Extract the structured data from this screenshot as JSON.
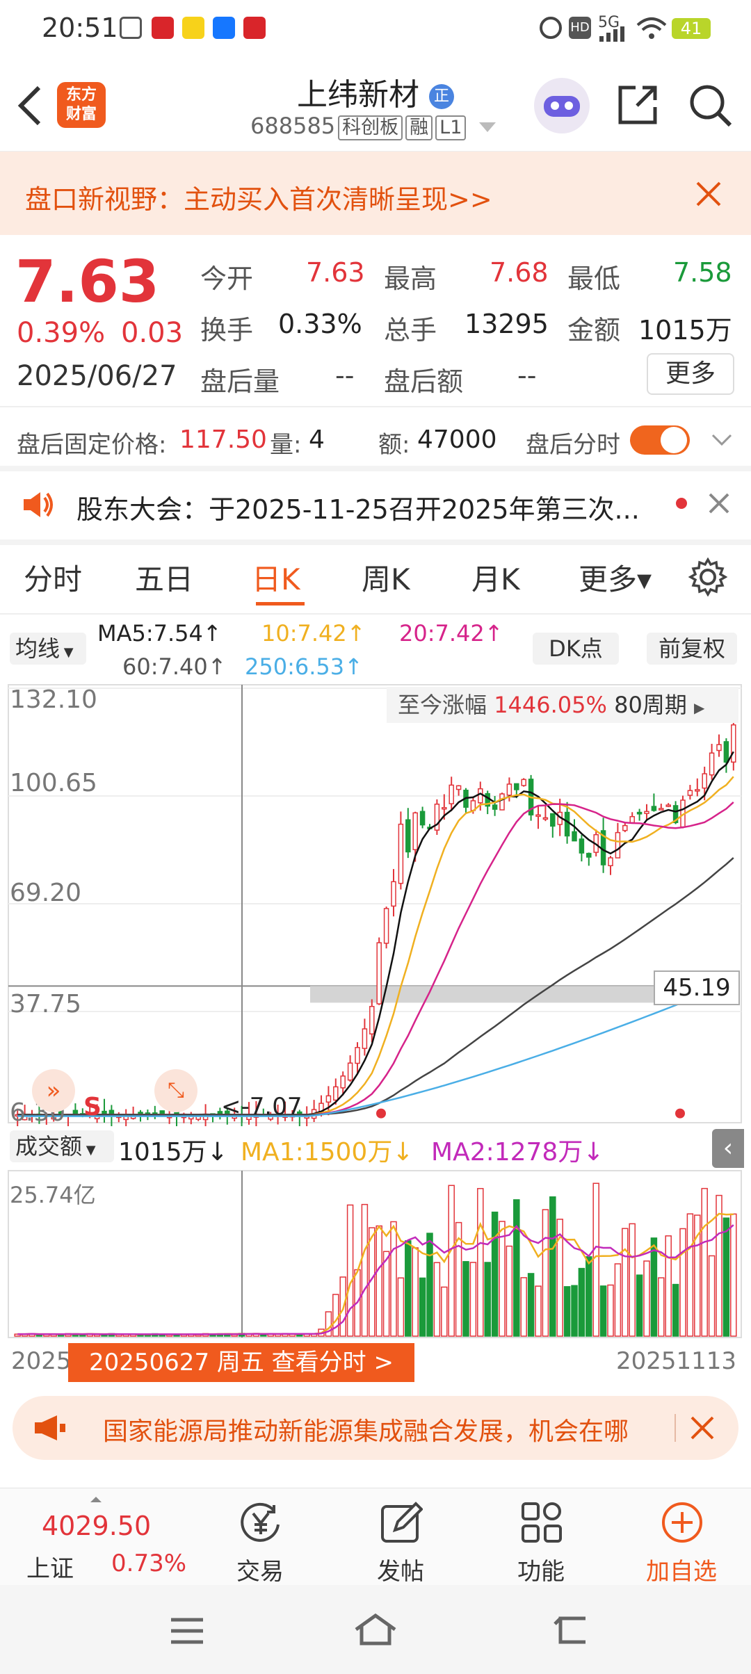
{
  "status_bar": {
    "time": "20:51",
    "battery": "41",
    "signal": "5G"
  },
  "header": {
    "back_icon": "chevron-left-icon",
    "logo_text_1": "东方",
    "logo_text_2": "财富",
    "stock_name": "上纬新材",
    "certified_badge": "正",
    "stock_code": "688585",
    "tags": [
      "科创板",
      "融",
      "L1"
    ]
  },
  "promo_banner": {
    "text": "盘口新视野：主动买入首次清晰呈现>>"
  },
  "quote": {
    "price": "7.63",
    "change_pct": "0.39%",
    "change_amt": "0.03",
    "date": "2025/06/27",
    "open_label": "今开",
    "open": "7.63",
    "high_label": "最高",
    "high": "7.68",
    "low_label": "最低",
    "low": "7.58",
    "turnover_label": "换手",
    "turnover": "0.33%",
    "volume_label": "总手",
    "volume": "13295",
    "amount_label": "金额",
    "amount": "1015万",
    "after_vol_label": "盘后量",
    "after_vol": "--",
    "after_amt_label": "盘后额",
    "after_amt": "--",
    "more_button": "更多"
  },
  "after_hours": {
    "fixed_price_label": "盘后固定价格:",
    "fixed_price": "117.50",
    "qty_label": "量:",
    "qty": "4",
    "amt_label": "额:",
    "amt": "47000",
    "timeshare_label": "盘后分时"
  },
  "notice": {
    "text": "股东大会：于2025-11-25召开2025年第三次..."
  },
  "tabs": [
    "分时",
    "五日",
    "日K",
    "周K",
    "月K",
    "更多▾"
  ],
  "active_tab": "日K",
  "ma_legend": {
    "selector": "均线",
    "ma5": "MA5:7.54↑",
    "ma10": "10:7.42↑",
    "ma20": "20:7.42↑",
    "ma60": "60:7.40↑",
    "ma250": "250:6.53↑",
    "dk_button": "DK点",
    "adjust_button": "前复权"
  },
  "chart_data": {
    "type": "candlestick",
    "y_ticks": [
      "132.10",
      "100.65",
      "69.20",
      "37.75",
      "6.30"
    ],
    "crosshair_price": "45.19",
    "min_label": "<-7.07",
    "gain_label": "至今涨幅",
    "gain_value": "1446.05%",
    "period_label": "80周期",
    "ylim": [
      6.3,
      132.1
    ],
    "colors": {
      "up": "#e2343a",
      "down": "#1a9a3a",
      "ma5": "#111111",
      "ma10": "#f0b020",
      "ma20": "#d6238a",
      "ma60": "#444444",
      "ma250": "#4aaee6"
    }
  },
  "volume_panel": {
    "selector": "成交额",
    "value": "1015万↓",
    "ma1": "MA1:1500万↓",
    "ma2": "MA2:1278万↓",
    "y_max": "25.74亿",
    "date_start": "2025",
    "date_end": "20251113",
    "date_tooltip": "20250627 周五 查看分时 >"
  },
  "news_ticker": {
    "text": "国家能源局推动新能源集成融合发展，机会在哪"
  },
  "bottom_nav": {
    "index_value": "4029.50",
    "index_name": "上证",
    "index_change": "0.73%",
    "trade": "交易",
    "post": "发帖",
    "function": "功能",
    "add_watch": "加自选"
  }
}
